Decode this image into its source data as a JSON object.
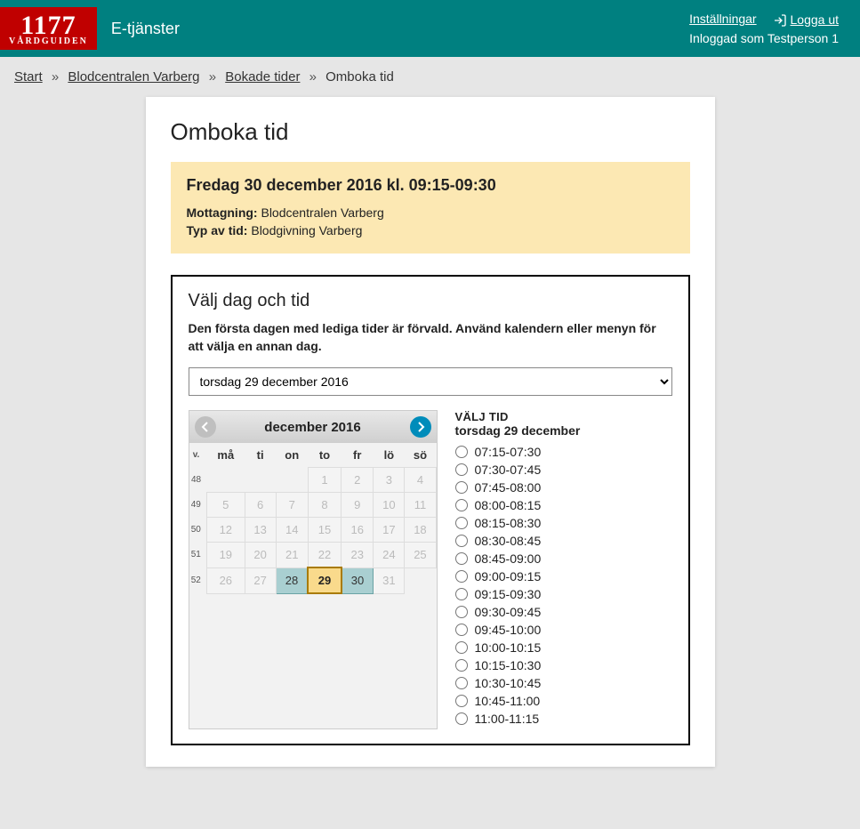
{
  "header": {
    "logo_main": "1177",
    "logo_sub": "VÅRDGUIDEN",
    "brand_sub": "E-tjänster",
    "settings": "Inställningar",
    "logout": "Logga ut",
    "logged_in_as": "Inloggad som Testperson 1"
  },
  "breadcrumb": {
    "items": [
      "Start",
      "Blodcentralen Varberg",
      "Bokade tider"
    ],
    "current": "Omboka tid",
    "sep": "»"
  },
  "page": {
    "title": "Omboka tid"
  },
  "info": {
    "title": "Fredag 30 december 2016 kl. 09:15-09:30",
    "reception_label": "Mottagning:",
    "reception_value": "Blodcentralen Varberg",
    "type_label": "Typ av tid:",
    "type_value": "Blodgivning Varberg"
  },
  "picker": {
    "heading": "Välj dag och tid",
    "intro": "Den första dagen med lediga tider är förvald. Använd kalendern eller menyn för att välja en annan dag.",
    "selected_date": "torsdag 29 december 2016"
  },
  "calendar": {
    "title": "december 2016",
    "week_label": "v.",
    "weekdays": [
      "må",
      "ti",
      "on",
      "to",
      "fr",
      "lö",
      "sö"
    ],
    "rows": [
      {
        "week": "48",
        "days": [
          {
            "d": "",
            "state": "blank"
          },
          {
            "d": "",
            "state": "blank"
          },
          {
            "d": "",
            "state": "blank"
          },
          {
            "d": "1",
            "state": "disabled"
          },
          {
            "d": "2",
            "state": "disabled"
          },
          {
            "d": "3",
            "state": "disabled"
          },
          {
            "d": "4",
            "state": "disabled"
          }
        ]
      },
      {
        "week": "49",
        "days": [
          {
            "d": "5",
            "state": "disabled"
          },
          {
            "d": "6",
            "state": "disabled"
          },
          {
            "d": "7",
            "state": "disabled"
          },
          {
            "d": "8",
            "state": "disabled"
          },
          {
            "d": "9",
            "state": "disabled"
          },
          {
            "d": "10",
            "state": "disabled"
          },
          {
            "d": "11",
            "state": "disabled"
          }
        ]
      },
      {
        "week": "50",
        "days": [
          {
            "d": "12",
            "state": "disabled"
          },
          {
            "d": "13",
            "state": "disabled"
          },
          {
            "d": "14",
            "state": "disabled"
          },
          {
            "d": "15",
            "state": "disabled"
          },
          {
            "d": "16",
            "state": "disabled"
          },
          {
            "d": "17",
            "state": "disabled"
          },
          {
            "d": "18",
            "state": "disabled"
          }
        ]
      },
      {
        "week": "51",
        "days": [
          {
            "d": "19",
            "state": "disabled"
          },
          {
            "d": "20",
            "state": "disabled"
          },
          {
            "d": "21",
            "state": "disabled"
          },
          {
            "d": "22",
            "state": "disabled"
          },
          {
            "d": "23",
            "state": "disabled"
          },
          {
            "d": "24",
            "state": "disabled"
          },
          {
            "d": "25",
            "state": "disabled"
          }
        ]
      },
      {
        "week": "52",
        "days": [
          {
            "d": "26",
            "state": "disabled"
          },
          {
            "d": "27",
            "state": "disabled"
          },
          {
            "d": "28",
            "state": "enabled"
          },
          {
            "d": "29",
            "state": "selected"
          },
          {
            "d": "30",
            "state": "enabled"
          },
          {
            "d": "31",
            "state": "disabled"
          },
          {
            "d": "",
            "state": "blank"
          }
        ]
      }
    ]
  },
  "times": {
    "heading": "VÄLJ TID",
    "sub": "torsdag 29 december",
    "slots": [
      "07:15-07:30",
      "07:30-07:45",
      "07:45-08:00",
      "08:00-08:15",
      "08:15-08:30",
      "08:30-08:45",
      "08:45-09:00",
      "09:00-09:15",
      "09:15-09:30",
      "09:30-09:45",
      "09:45-10:00",
      "10:00-10:15",
      "10:15-10:30",
      "10:30-10:45",
      "10:45-11:00",
      "11:00-11:15"
    ]
  }
}
